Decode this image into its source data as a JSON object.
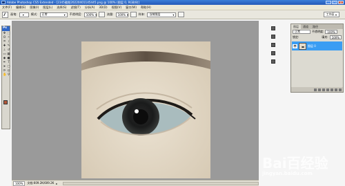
{
  "title_bar": {
    "title": "Adobe Photoshop CS5 Extended - [2345截图20220401145445.png @ 100% (图层 0, RGB/8)]"
  },
  "menu": [
    "文件(F)",
    "编辑(E)",
    "图像(I)",
    "图层(L)",
    "选择(S)",
    "滤镜(T)",
    "分析(A)",
    "3D(D)",
    "视图(V)",
    "窗口(W)",
    "帮助(H)"
  ],
  "options": {
    "brush_label": "画笔:",
    "mode_label": "模式:",
    "mode_value": "正常",
    "opacity_label": "不透明度:",
    "opacity_value": "100%",
    "flow_label": "流量:",
    "flow_value": "100%",
    "sample_label": "样本:",
    "sample_value": "当前图层",
    "workspace": "工作区"
  },
  "toolbox": {
    "logo": "Ps"
  },
  "status": {
    "zoom": "100%",
    "info": "文档:609.2K/609.2K"
  },
  "layers_panel": {
    "tabs": [
      "图层",
      "通道",
      "路径"
    ],
    "blend_mode": "正常",
    "opacity_label": "不透明度:",
    "opacity_value": "100%",
    "lock_label": "锁定:",
    "fill_label": "填充:",
    "fill_value": "100%",
    "layer_name": "图层 0"
  },
  "collapsed_panels": [
    "",
    "",
    "",
    "",
    ""
  ],
  "watermark": {
    "main": "Bai百经验",
    "sub": "jingyan.baidu.com"
  },
  "colors": {
    "foreground": "#b4583a",
    "background": "#ffffff",
    "accent": "#3a9df3"
  }
}
